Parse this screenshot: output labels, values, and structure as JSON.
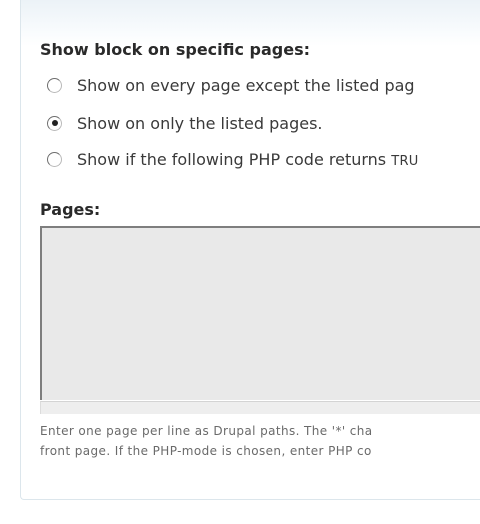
{
  "visibility": {
    "heading": "Show block on specific pages:",
    "options": [
      {
        "label": "Show on every page except the listed pag",
        "checked": false
      },
      {
        "label": "Show on only the listed pages.",
        "checked": true
      },
      {
        "label": "Show if the following PHP code returns ",
        "code": "TRU",
        "checked": false
      }
    ]
  },
  "pages": {
    "label": "Pages:",
    "value": "",
    "description_line1": "Enter one page per line as Drupal paths. The '*' cha",
    "description_line2": "front page. If the PHP-mode is chosen, enter PHP co"
  }
}
